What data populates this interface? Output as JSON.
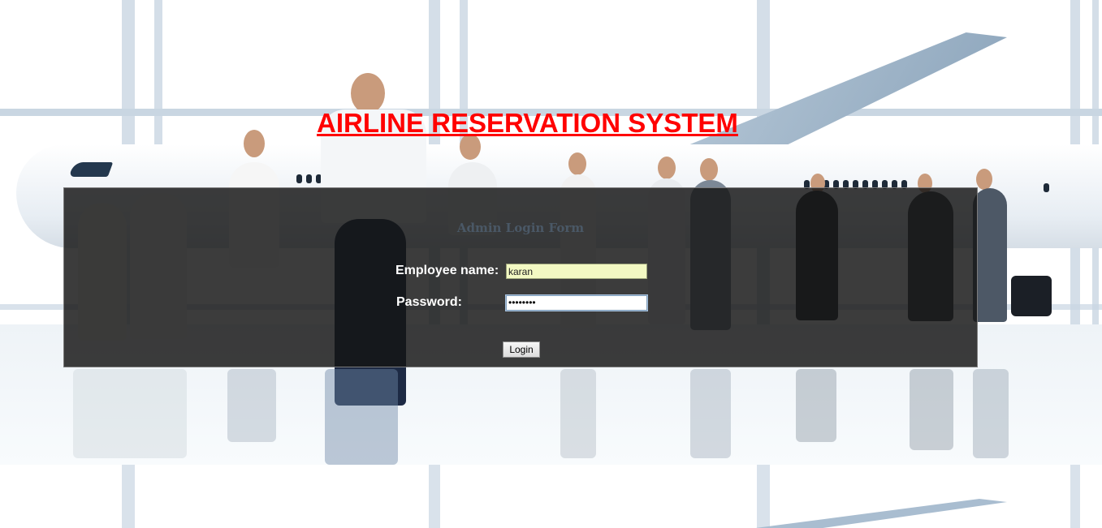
{
  "page": {
    "title": "AIRLINE RESERVATION SYSTEM"
  },
  "form": {
    "heading": "Admin Login Form",
    "employee_name_label": "Employee name:",
    "employee_name_value": "karan",
    "password_label": "Password:",
    "password_value": "••••••••",
    "login_button_label": "Login"
  },
  "colors": {
    "title": "#ff0000",
    "panel_background": "#141414",
    "name_field_background": "#f3f9c3",
    "heading": "#4a5866"
  }
}
